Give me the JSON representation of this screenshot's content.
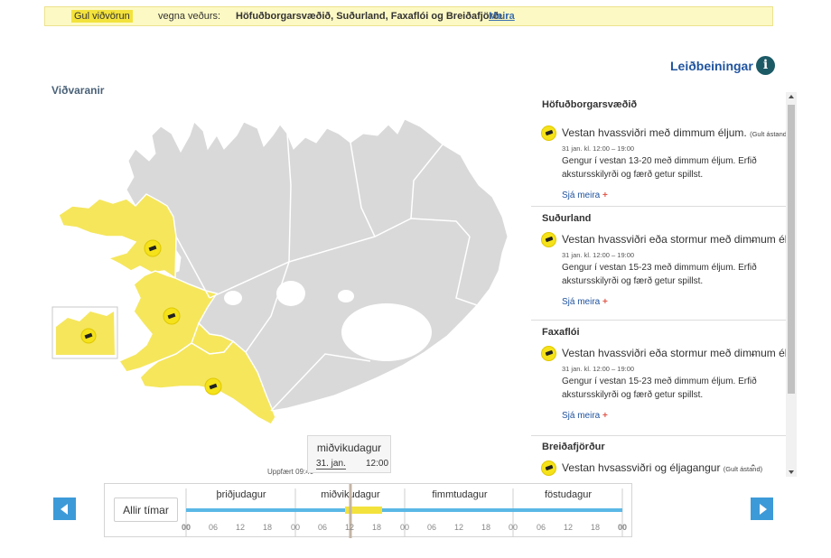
{
  "banner": {
    "level": "Gul viðvörun",
    "text": "vegna veðurs:",
    "regions": "Höfuðborgarsvæðið, Suðurland, Faxaflói og Breiðafjörður",
    "more": "Meira"
  },
  "guide": {
    "label": "Leiðbeiningar",
    "icon": "info-icon"
  },
  "map": {
    "title": "Viðvaranir",
    "updated": "Uppfært 09:40",
    "warning_color": "#f5e65c",
    "land_color": "#d9d9d9",
    "warning_regions": [
      "Breiðafjörður",
      "Faxaflói",
      "Höfuðborgarsvæðið",
      "Suðurland"
    ]
  },
  "warnings": [
    {
      "region": "Höfuðborgarsvæðið",
      "title": "Vestan hvassviðri með dimmum éljum.",
      "level": "(Gult ástand)",
      "date": "31 jan. kl. 12:00 – 19:00",
      "description": "Gengur í vestan 13-20 með dimmum éljum. Erfið akstursskilyrði og færð getur spillst.",
      "see_more": "Sjá meira"
    },
    {
      "region": "Suðurland",
      "title": "Vestan hvassviðri eða stormur með dimmum éljum",
      "level": "",
      "date": "31 jan. kl. 12:00 – 19:00",
      "description": "Gengur í vestan 15-23 með dimmum éljum. Erfið akstursskilyrði og færð getur spillst.",
      "see_more": "Sjá meira"
    },
    {
      "region": "Faxaflói",
      "title": "Vestan hvassviðri eða stormur með dimmum éljum",
      "level": "",
      "date": "31 jan. kl. 12:00 – 19:00",
      "description": "Gengur í vestan 15-23 með dimmum éljum. Erfið akstursskilyrði og færð getur spillst.",
      "see_more": "Sjá meira"
    },
    {
      "region": "Breiðafjörður",
      "title": "Vestan hvsassviðri og éljagangur",
      "level": "(Gult ástand)",
      "date": "",
      "description": "",
      "see_more": ""
    }
  ],
  "tooltip": {
    "day": "miðvikudagur",
    "date": "31. jan.",
    "time": "12:00"
  },
  "timeline": {
    "all_times": "Allir tímar",
    "days": [
      "þriðjudagur",
      "miðvikudagur",
      "fimmtudagur",
      "föstudagur"
    ],
    "hours": [
      "00",
      "06",
      "12",
      "18",
      "00",
      "06",
      "12",
      "18",
      "00",
      "06",
      "12",
      "18",
      "00",
      "06",
      "12",
      "18",
      "00"
    ],
    "track_color": "#5bb8e6",
    "active_color": "#f3e23c"
  }
}
